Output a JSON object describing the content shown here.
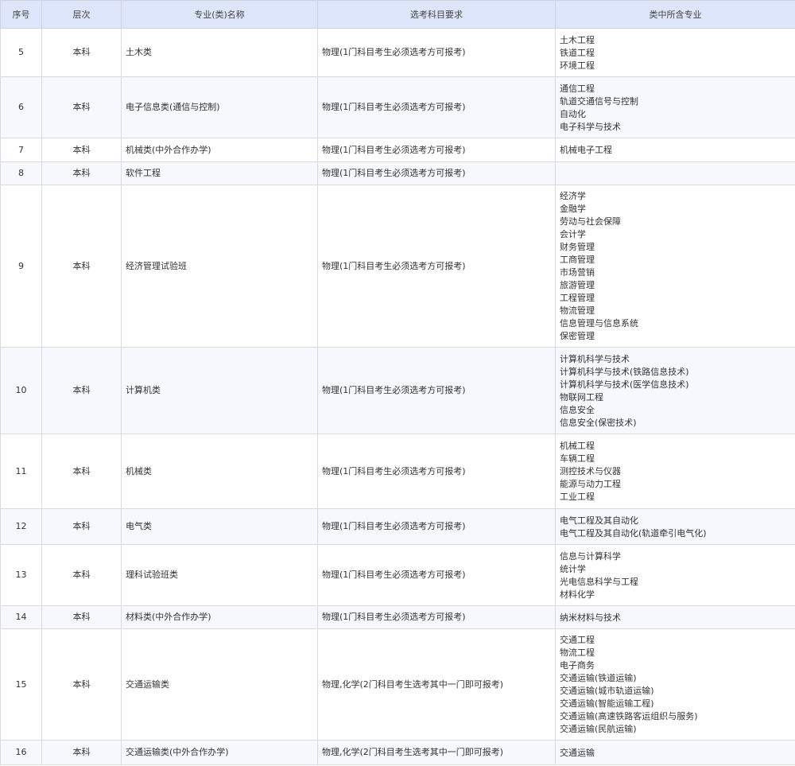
{
  "colors": {
    "header_bg": "#dde6fa",
    "row_alt_bg": "#f7f8fd",
    "border": "#d8dbe2",
    "text": "#333333"
  },
  "headers": {
    "seq": "序号",
    "level": "层次",
    "major": "专业(类)名称",
    "requirement": "选考科目要求",
    "included": "类中所含专业"
  },
  "rows": [
    {
      "seq": "5",
      "level": "本科",
      "major": "土木类",
      "requirement": "物理(1门科目考生必须选考方可报考)",
      "included": [
        "土木工程",
        "铁道工程",
        "环境工程"
      ]
    },
    {
      "seq": "6",
      "level": "本科",
      "major": "电子信息类(通信与控制)",
      "requirement": "物理(1门科目考生必须选考方可报考)",
      "included": [
        "通信工程",
        "轨道交通信号与控制",
        "自动化",
        "电子科学与技术"
      ]
    },
    {
      "seq": "7",
      "level": "本科",
      "major": "机械类(中外合作办学)",
      "requirement": "物理(1门科目考生必须选考方可报考)",
      "included": [
        "机械电子工程"
      ]
    },
    {
      "seq": "8",
      "level": "本科",
      "major": "软件工程",
      "requirement": "物理(1门科目考生必须选考方可报考)",
      "included": []
    },
    {
      "seq": "9",
      "level": "本科",
      "major": "经济管理试验班",
      "requirement": "物理(1门科目考生必须选考方可报考)",
      "included": [
        "经济学",
        "金融学",
        "劳动与社会保障",
        "会计学",
        "财务管理",
        "工商管理",
        "市场营销",
        "旅游管理",
        "工程管理",
        "物流管理",
        "信息管理与信息系统",
        "保密管理"
      ]
    },
    {
      "seq": "10",
      "level": "本科",
      "major": "计算机类",
      "requirement": "物理(1门科目考生必须选考方可报考)",
      "included": [
        "计算机科学与技术",
        "计算机科学与技术(铁路信息技术)",
        "计算机科学与技术(医学信息技术)",
        "物联网工程",
        "信息安全",
        "信息安全(保密技术)"
      ]
    },
    {
      "seq": "11",
      "level": "本科",
      "major": "机械类",
      "requirement": "物理(1门科目考生必须选考方可报考)",
      "included": [
        "机械工程",
        "车辆工程",
        "测控技术与仪器",
        "能源与动力工程",
        "工业工程"
      ]
    },
    {
      "seq": "12",
      "level": "本科",
      "major": "电气类",
      "requirement": "物理(1门科目考生必须选考方可报考)",
      "included": [
        "电气工程及其自动化",
        "电气工程及其自动化(轨道牵引电气化)"
      ]
    },
    {
      "seq": "13",
      "level": "本科",
      "major": "理科试验班类",
      "requirement": "物理(1门科目考生必须选考方可报考)",
      "included": [
        "信息与计算科学",
        "统计学",
        "光电信息科学与工程",
        "材料化学"
      ]
    },
    {
      "seq": "14",
      "level": "本科",
      "major": "材料类(中外合作办学)",
      "requirement": "物理(1门科目考生必须选考方可报考)",
      "included": [
        "纳米材料与技术"
      ]
    },
    {
      "seq": "15",
      "level": "本科",
      "major": "交通运输类",
      "requirement": "物理,化学(2门科目考生选考其中一门即可报考)",
      "included": [
        "交通工程",
        "物流工程",
        "电子商务",
        "交通运输(铁道运输)",
        "交通运输(城市轨道运输)",
        "交通运输(智能运输工程)",
        "交通运输(高速铁路客运组织与服务)",
        "交通运输(民航运输)"
      ]
    },
    {
      "seq": "16",
      "level": "本科",
      "major": "交通运输类(中外合作办学)",
      "requirement": "物理,化学(2门科目考生选考其中一门即可报考)",
      "included": [
        "交通运输"
      ]
    }
  ]
}
